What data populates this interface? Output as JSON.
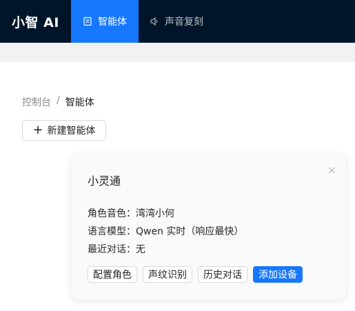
{
  "header": {
    "brand": "小智 AI",
    "nav": [
      {
        "label": "智能体",
        "icon": "agent-icon",
        "active": true
      },
      {
        "label": "声音复刻",
        "icon": "speaker-icon",
        "active": false
      }
    ]
  },
  "breadcrumb": {
    "parent": "控制台",
    "separator": "/",
    "current": "智能体"
  },
  "toolbar": {
    "new_agent_label": "新建智能体",
    "plus_icon": "+"
  },
  "agent_card": {
    "name": "小灵通",
    "close_icon": "×",
    "fields": [
      {
        "label": "角色音色：",
        "value": "湾湾小何"
      },
      {
        "label": "语言模型：",
        "value": "Qwen 实时（响应最快）"
      },
      {
        "label": "最近对话：",
        "value": "无"
      }
    ],
    "actions": {
      "configure_role": "配置角色",
      "voiceprint": "声纹识别",
      "history": "历史对话",
      "add_device": "添加设备"
    }
  },
  "colors": {
    "header_bg": "#001529",
    "accent": "#1677ff"
  }
}
